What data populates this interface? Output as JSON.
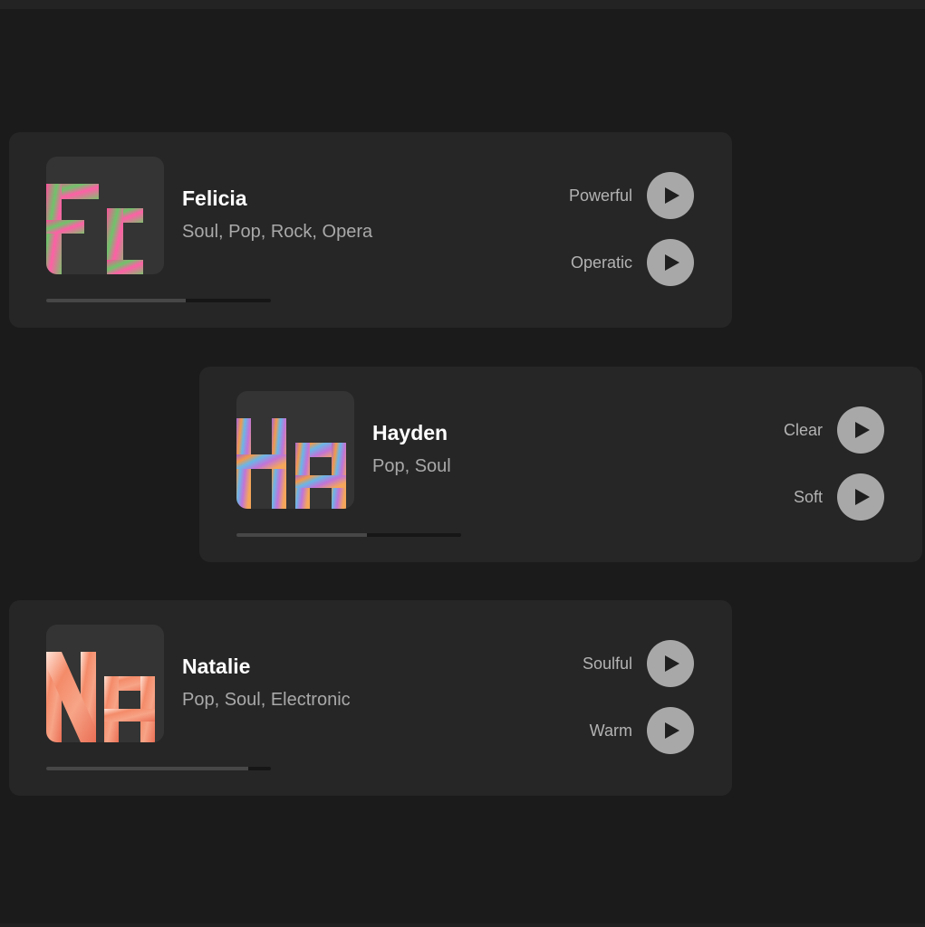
{
  "voices": [
    {
      "monogram": "Fc",
      "name": "Felicia",
      "genres": "Soul, Pop, Rock, Opera",
      "progress": 0.62,
      "samples": [
        {
          "label": "Powerful"
        },
        {
          "label": "Operatic"
        }
      ],
      "colors": [
        "#ff4f9d",
        "#6fc36a",
        "#d45aa8"
      ]
    },
    {
      "monogram": "Ha",
      "name": "Hayden",
      "genres": "Pop, Soul",
      "progress": 0.58,
      "samples": [
        {
          "label": "Clear"
        },
        {
          "label": "Soft"
        }
      ],
      "colors": [
        "#a766d9",
        "#f29a4a",
        "#6ab6e6"
      ]
    },
    {
      "monogram": "Na",
      "name": "Natalie",
      "genres": "Pop, Soul, Electronic",
      "progress": 0.9,
      "samples": [
        {
          "label": "Soulful"
        },
        {
          "label": "Warm"
        }
      ],
      "colors": [
        "#f48b69",
        "#ffd4c2",
        "#ea6f55"
      ]
    }
  ],
  "icons": {
    "play": "play-icon"
  }
}
